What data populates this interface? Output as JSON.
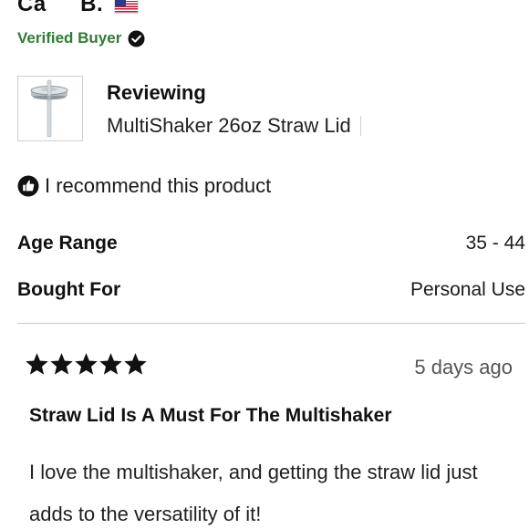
{
  "reviewer": {
    "name": "Ca   B.",
    "flag": "us-flag-icon",
    "verified_label": "Verified Buyer",
    "verified_color": "#2e7d32"
  },
  "product": {
    "reviewing_label": "Reviewing",
    "name": "MultiShaker 26oz Straw Lid"
  },
  "recommend": {
    "text": "I recommend this product",
    "icon": "thumbs-up-icon"
  },
  "attributes": [
    {
      "label": "Age Range",
      "value": "35 - 44"
    },
    {
      "label": "Bought For",
      "value": "Personal Use"
    }
  ],
  "review": {
    "rating": 5,
    "date": "5 days ago",
    "title": "Straw Lid Is A Must For The Multishaker",
    "body": "I love the multishaker, and getting the straw lid just adds to the versatility of it!"
  }
}
